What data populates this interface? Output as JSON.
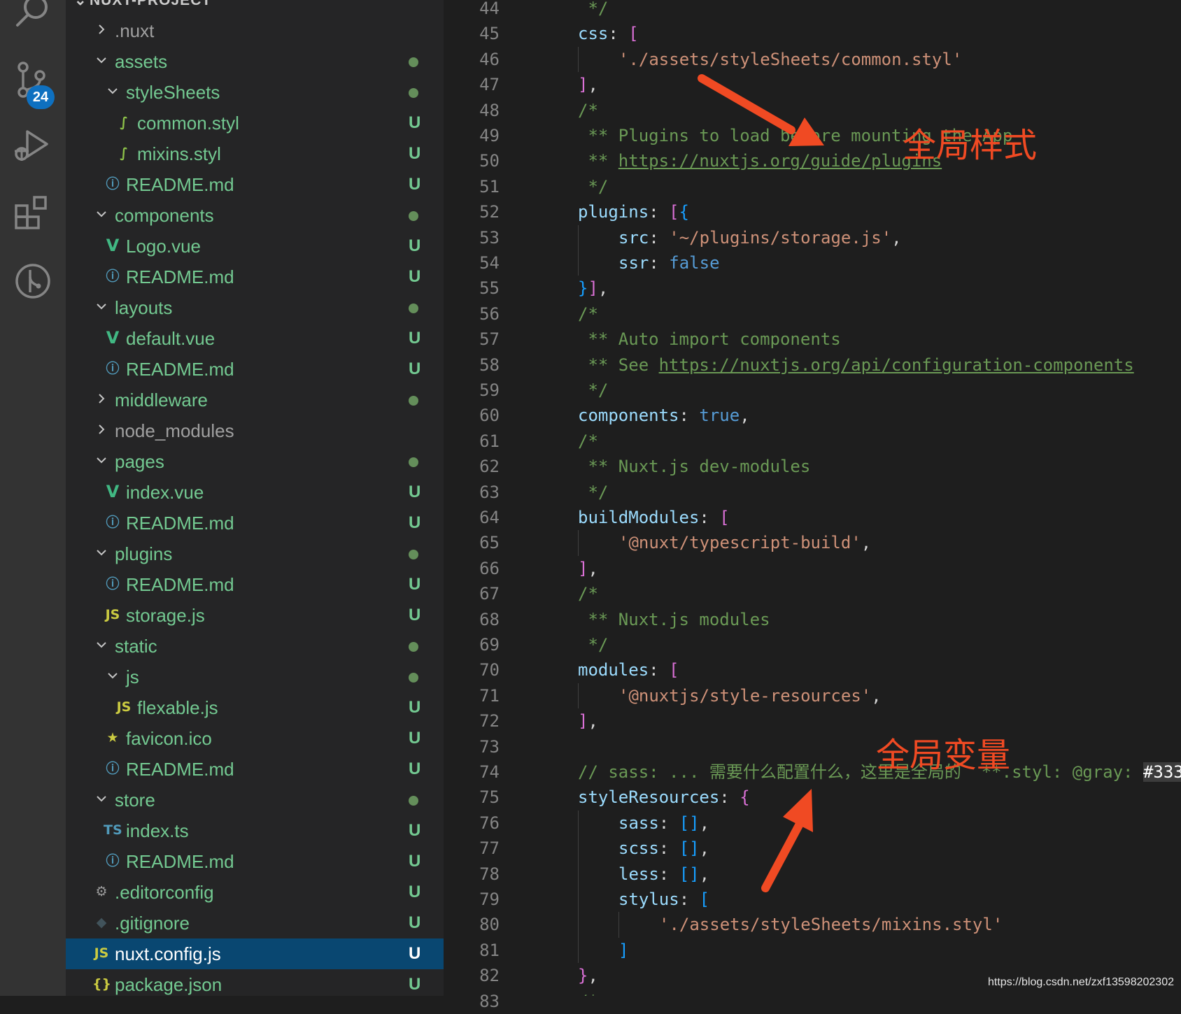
{
  "activity_bar": {
    "source_control_badge": "24"
  },
  "explorer": {
    "header": "NUXT-PROJECT",
    "items": [
      {
        "name": ".nuxt",
        "depth": 1,
        "kind": "folder",
        "expanded": false,
        "color": "grey",
        "status": ""
      },
      {
        "name": "assets",
        "depth": 1,
        "kind": "folder",
        "expanded": true,
        "color": "green",
        "status": "dot"
      },
      {
        "name": "styleSheets",
        "depth": 2,
        "kind": "folder",
        "expanded": true,
        "color": "green",
        "status": "dot"
      },
      {
        "name": "common.styl",
        "depth": 3,
        "kind": "stylus",
        "color": "green",
        "status": "U"
      },
      {
        "name": "mixins.styl",
        "depth": 3,
        "kind": "stylus",
        "color": "green",
        "status": "U"
      },
      {
        "name": "README.md",
        "depth": 2,
        "kind": "info",
        "color": "green",
        "status": "U"
      },
      {
        "name": "components",
        "depth": 1,
        "kind": "folder",
        "expanded": true,
        "color": "green",
        "status": "dot"
      },
      {
        "name": "Logo.vue",
        "depth": 2,
        "kind": "vue",
        "color": "green",
        "status": "U"
      },
      {
        "name": "README.md",
        "depth": 2,
        "kind": "info",
        "color": "green",
        "status": "U"
      },
      {
        "name": "layouts",
        "depth": 1,
        "kind": "folder",
        "expanded": true,
        "color": "green",
        "status": "dot"
      },
      {
        "name": "default.vue",
        "depth": 2,
        "kind": "vue",
        "color": "green",
        "status": "U"
      },
      {
        "name": "README.md",
        "depth": 2,
        "kind": "info",
        "color": "green",
        "status": "U"
      },
      {
        "name": "middleware",
        "depth": 1,
        "kind": "folder",
        "expanded": false,
        "color": "green",
        "status": "dot"
      },
      {
        "name": "node_modules",
        "depth": 1,
        "kind": "folder",
        "expanded": false,
        "color": "grey",
        "status": ""
      },
      {
        "name": "pages",
        "depth": 1,
        "kind": "folder",
        "expanded": true,
        "color": "green",
        "status": "dot"
      },
      {
        "name": "index.vue",
        "depth": 2,
        "kind": "vue",
        "color": "green",
        "status": "U"
      },
      {
        "name": "README.md",
        "depth": 2,
        "kind": "info",
        "color": "green",
        "status": "U"
      },
      {
        "name": "plugins",
        "depth": 1,
        "kind": "folder",
        "expanded": true,
        "color": "green",
        "status": "dot"
      },
      {
        "name": "README.md",
        "depth": 2,
        "kind": "info",
        "color": "green",
        "status": "U"
      },
      {
        "name": "storage.js",
        "depth": 2,
        "kind": "js",
        "color": "green",
        "status": "U"
      },
      {
        "name": "static",
        "depth": 1,
        "kind": "folder",
        "expanded": true,
        "color": "green",
        "status": "dot"
      },
      {
        "name": "js",
        "depth": 2,
        "kind": "folder",
        "expanded": true,
        "color": "green",
        "status": "dot"
      },
      {
        "name": "flexable.js",
        "depth": 3,
        "kind": "js",
        "color": "green",
        "status": "U"
      },
      {
        "name": "favicon.ico",
        "depth": 2,
        "kind": "star",
        "color": "green",
        "status": "U"
      },
      {
        "name": "README.md",
        "depth": 2,
        "kind": "info",
        "color": "green",
        "status": "U"
      },
      {
        "name": "store",
        "depth": 1,
        "kind": "folder",
        "expanded": true,
        "color": "green",
        "status": "dot"
      },
      {
        "name": "index.ts",
        "depth": 2,
        "kind": "ts",
        "color": "green",
        "status": "U"
      },
      {
        "name": "README.md",
        "depth": 2,
        "kind": "info",
        "color": "green",
        "status": "U"
      },
      {
        "name": ".editorconfig",
        "depth": 1,
        "kind": "gear",
        "color": "green",
        "status": "U"
      },
      {
        "name": ".gitignore",
        "depth": 1,
        "kind": "git",
        "color": "green",
        "status": "U"
      },
      {
        "name": "nuxt.config.js",
        "depth": 1,
        "kind": "js",
        "color": "white",
        "status": "U",
        "selected": true
      },
      {
        "name": "package.json",
        "depth": 1,
        "kind": "json",
        "color": "green",
        "status": "U"
      }
    ]
  },
  "editor": {
    "first_line": 44,
    "lines": [
      {
        "indent": 0,
        "tokens": [
          [
            "com",
            " */"
          ]
        ]
      },
      {
        "indent": 0,
        "tokens": [
          [
            "key",
            "css"
          ],
          [
            "punc",
            ": "
          ],
          [
            "br1",
            "["
          ]
        ]
      },
      {
        "indent": 1,
        "tokens": [
          [
            "str",
            "'./assets/styleSheets/common.styl'"
          ]
        ]
      },
      {
        "indent": 0,
        "tokens": [
          [
            "br1",
            "]"
          ],
          [
            "punc",
            ","
          ]
        ]
      },
      {
        "indent": 0,
        "tokens": [
          [
            "com",
            "/*"
          ]
        ]
      },
      {
        "indent": 0,
        "tokens": [
          [
            "com",
            " ** Plugins to load before mounting the App"
          ]
        ]
      },
      {
        "indent": 0,
        "tokens": [
          [
            "com",
            " ** "
          ],
          [
            "link",
            "https://nuxtjs.org/guide/plugins"
          ]
        ]
      },
      {
        "indent": 0,
        "tokens": [
          [
            "com",
            " */"
          ]
        ]
      },
      {
        "indent": 0,
        "tokens": [
          [
            "key",
            "plugins"
          ],
          [
            "punc",
            ": "
          ],
          [
            "br1",
            "["
          ],
          [
            "br2",
            "{"
          ]
        ]
      },
      {
        "indent": 1,
        "tokens": [
          [
            "key",
            "src"
          ],
          [
            "punc",
            ": "
          ],
          [
            "str",
            "'~/plugins/storage.js'"
          ],
          [
            "punc",
            ","
          ]
        ]
      },
      {
        "indent": 1,
        "tokens": [
          [
            "key",
            "ssr"
          ],
          [
            "punc",
            ": "
          ],
          [
            "bool",
            "false"
          ]
        ]
      },
      {
        "indent": 0,
        "tokens": [
          [
            "br2",
            "}"
          ],
          [
            "br1",
            "]"
          ],
          [
            "punc",
            ","
          ]
        ]
      },
      {
        "indent": 0,
        "tokens": [
          [
            "com",
            "/*"
          ]
        ]
      },
      {
        "indent": 0,
        "tokens": [
          [
            "com",
            " ** Auto import components"
          ]
        ]
      },
      {
        "indent": 0,
        "tokens": [
          [
            "com",
            " ** See "
          ],
          [
            "link",
            "https://nuxtjs.org/api/configuration-components"
          ]
        ]
      },
      {
        "indent": 0,
        "tokens": [
          [
            "com",
            " */"
          ]
        ]
      },
      {
        "indent": 0,
        "tokens": [
          [
            "key",
            "components"
          ],
          [
            "punc",
            ": "
          ],
          [
            "bool",
            "true"
          ],
          [
            "punc",
            ","
          ]
        ]
      },
      {
        "indent": 0,
        "tokens": [
          [
            "com",
            "/*"
          ]
        ]
      },
      {
        "indent": 0,
        "tokens": [
          [
            "com",
            " ** Nuxt.js dev-modules"
          ]
        ]
      },
      {
        "indent": 0,
        "tokens": [
          [
            "com",
            " */"
          ]
        ]
      },
      {
        "indent": 0,
        "tokens": [
          [
            "key",
            "buildModules"
          ],
          [
            "punc",
            ": "
          ],
          [
            "br1",
            "["
          ]
        ]
      },
      {
        "indent": 1,
        "tokens": [
          [
            "str",
            "'@nuxt/typescript-build'"
          ],
          [
            "punc",
            ","
          ]
        ]
      },
      {
        "indent": 0,
        "tokens": [
          [
            "br1",
            "]"
          ],
          [
            "punc",
            ","
          ]
        ]
      },
      {
        "indent": 0,
        "tokens": [
          [
            "com",
            "/*"
          ]
        ]
      },
      {
        "indent": 0,
        "tokens": [
          [
            "com",
            " ** Nuxt.js modules"
          ]
        ]
      },
      {
        "indent": 0,
        "tokens": [
          [
            "com",
            " */"
          ]
        ]
      },
      {
        "indent": 0,
        "tokens": [
          [
            "key",
            "modules"
          ],
          [
            "punc",
            ": "
          ],
          [
            "br1",
            "["
          ]
        ]
      },
      {
        "indent": 1,
        "tokens": [
          [
            "str",
            "'@nuxtjs/style-resources'"
          ],
          [
            "punc",
            ","
          ]
        ]
      },
      {
        "indent": 0,
        "tokens": [
          [
            "br1",
            "]"
          ],
          [
            "punc",
            ","
          ]
        ]
      },
      {
        "indent": 0,
        "tokens": []
      },
      {
        "indent": 0,
        "tokens": [
          [
            "com",
            "// sass: ... 需要什么配置什么，这里是全局的  **.styl: @gray: "
          ],
          [
            "hl",
            "#333"
          ]
        ]
      },
      {
        "indent": 0,
        "tokens": [
          [
            "key",
            "styleResources"
          ],
          [
            "punc",
            ": "
          ],
          [
            "br1",
            "{"
          ]
        ]
      },
      {
        "indent": 1,
        "tokens": [
          [
            "key",
            "sass"
          ],
          [
            "punc",
            ": "
          ],
          [
            "br2",
            "[]"
          ],
          [
            "punc",
            ","
          ]
        ]
      },
      {
        "indent": 1,
        "tokens": [
          [
            "key",
            "scss"
          ],
          [
            "punc",
            ": "
          ],
          [
            "br2",
            "[]"
          ],
          [
            "punc",
            ","
          ]
        ]
      },
      {
        "indent": 1,
        "tokens": [
          [
            "key",
            "less"
          ],
          [
            "punc",
            ": "
          ],
          [
            "br2",
            "[]"
          ],
          [
            "punc",
            ","
          ]
        ]
      },
      {
        "indent": 1,
        "tokens": [
          [
            "key",
            "stylus"
          ],
          [
            "punc",
            ": "
          ],
          [
            "br2",
            "["
          ]
        ]
      },
      {
        "indent": 2,
        "tokens": [
          [
            "str",
            "'./assets/styleSheets/mixins.styl'"
          ]
        ]
      },
      {
        "indent": 1,
        "tokens": [
          [
            "br2",
            "]"
          ]
        ]
      },
      {
        "indent": 0,
        "tokens": [
          [
            "br1",
            "}"
          ],
          [
            "punc",
            ","
          ]
        ]
      },
      {
        "indent": 0,
        "tokens": [
          [
            "com",
            "/*"
          ]
        ]
      }
    ]
  },
  "annotations": {
    "global_style": "全局样式",
    "global_variables": "全局变量",
    "color": "#f04a23"
  },
  "watermark": "https://blog.csdn.net/zxf13598202302"
}
